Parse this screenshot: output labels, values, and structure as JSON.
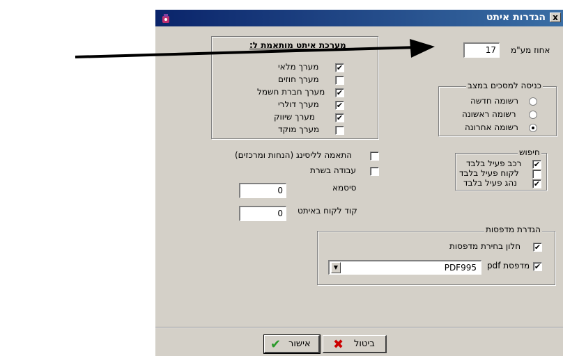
{
  "window": {
    "title": "הגדרות איתט",
    "close_label": "x"
  },
  "track_interval": {
    "label": "אחוז מע\"מ",
    "value": "17"
  },
  "tracking_systems": {
    "title": "מערכת איתט מותאמת ל:",
    "items": [
      {
        "label": "מערך מלאי",
        "checked": true
      },
      {
        "label": "מערך חוזים",
        "checked": false
      },
      {
        "label": "מערך חברת חשמל",
        "checked": true
      },
      {
        "label": "מערך דולרי",
        "checked": true
      },
      {
        "label": "מערך שיווק",
        "checked": true
      },
      {
        "label": "מערך מוקד",
        "checked": false
      }
    ]
  },
  "entry_mode": {
    "title": "כניסה למסכים במצב",
    "options": [
      {
        "label": "רשומה חדשה",
        "selected": false
      },
      {
        "label": "רשומה ראשונה",
        "selected": false
      },
      {
        "label": "רשומה אחרונה",
        "selected": true
      }
    ]
  },
  "search": {
    "title": "חיפוש",
    "items": [
      {
        "label": "רכב פעיל בלבד",
        "checked": true
      },
      {
        "label": "לקוח פעיל בלבד",
        "checked": false
      },
      {
        "label": "נהג פעיל בלבד",
        "checked": true
      }
    ]
  },
  "options": {
    "leasing_label": "התאמה לליסינג (הנחות ומרכזים)",
    "leasing_checked": false,
    "network_label": "עבודה בשרת",
    "network_checked": false
  },
  "password": {
    "label": "סיסמא",
    "value": "0"
  },
  "customer_code": {
    "label": "קוד לקוח באיתט",
    "value": "0"
  },
  "printers": {
    "title": "הגדרת מדפסות",
    "select_window_label": "חלון בחירת מדפסות",
    "select_window_checked": true,
    "pdf_label": "pdf מדפסת",
    "pdf_checked": true,
    "pdf_value": "PDF995"
  },
  "buttons": {
    "cancel": "ביטול",
    "ok": "אישור"
  },
  "colors": {
    "title_bar_start": "#0a246a",
    "title_bar_end": "#3a6ea5",
    "window_bg": "#d4d0c8",
    "cancel_icon": "#cc0000",
    "ok_icon": "#2a9a2a"
  },
  "icons": {
    "check_mark": "✔",
    "dropdown": "▼"
  }
}
